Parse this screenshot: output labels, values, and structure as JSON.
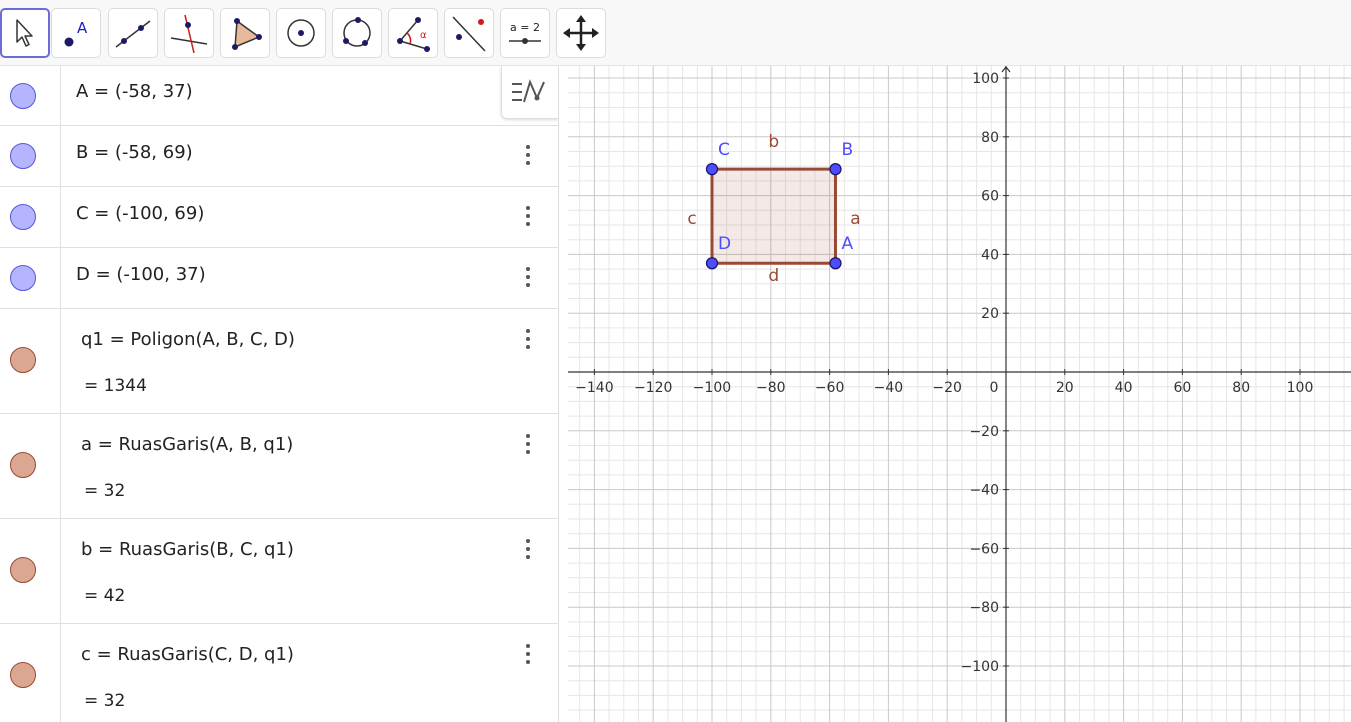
{
  "toolbar": {
    "tools": [
      {
        "name": "move",
        "label": "",
        "icon": "arrow-cursor-icon",
        "active": true
      },
      {
        "name": "point",
        "label": "A",
        "icon": "point-icon",
        "active": false
      },
      {
        "name": "line",
        "label": "",
        "icon": "line-icon",
        "active": false
      },
      {
        "name": "perpendicular",
        "label": "",
        "icon": "perpendicular-line-icon",
        "active": false
      },
      {
        "name": "polygon",
        "label": "",
        "icon": "polygon-icon",
        "active": false
      },
      {
        "name": "circle-center",
        "label": "",
        "icon": "circle-center-icon",
        "active": false
      },
      {
        "name": "circle-3-points",
        "label": "",
        "icon": "circle-three-points-icon",
        "active": false
      },
      {
        "name": "angle",
        "label": "α",
        "icon": "angle-icon",
        "active": false
      },
      {
        "name": "reflect",
        "label": "",
        "icon": "reflect-icon",
        "active": false
      },
      {
        "name": "slider",
        "label": "a = 2",
        "icon": "slider-icon",
        "active": false
      },
      {
        "name": "move-graphics",
        "label": "",
        "icon": "move-arrows-icon",
        "active": false
      }
    ]
  },
  "algebra": {
    "rows": [
      {
        "def": "A = (-58, 37)",
        "value": "",
        "type": "point"
      },
      {
        "def": "B = (-58, 69)",
        "value": "",
        "type": "point"
      },
      {
        "def": "C = (-100, 69)",
        "value": "",
        "type": "point"
      },
      {
        "def": "D = (-100, 37)",
        "value": "",
        "type": "point"
      },
      {
        "def": "q1  =  Poligon(A, B, C, D)",
        "value": "=  1344",
        "type": "shape"
      },
      {
        "def": "a  =  RuasGaris(A, B, q1)",
        "value": "=  32",
        "type": "shape"
      },
      {
        "def": "b  =  RuasGaris(B, C, q1)",
        "value": "=  42",
        "type": "shape"
      },
      {
        "def": "c  =  RuasGaris(C, D, q1)",
        "value": "=  32",
        "type": "shape"
      }
    ]
  },
  "graphics": {
    "x_ticks": [
      "−140",
      "−120",
      "−100",
      "−80",
      "−60",
      "−40",
      "−20",
      "0",
      "20",
      "40",
      "60",
      "80",
      "100"
    ],
    "y_ticks": [
      "100",
      "80",
      "60",
      "40",
      "20",
      "−20",
      "−40",
      "−60",
      "−80",
      "−100"
    ],
    "points": [
      {
        "name": "A",
        "x": -58,
        "y": 37
      },
      {
        "name": "B",
        "x": -58,
        "y": 69
      },
      {
        "name": "C",
        "x": -100,
        "y": 69
      },
      {
        "name": "D",
        "x": -100,
        "y": 37
      }
    ],
    "segments": [
      {
        "name": "a",
        "from": "A",
        "to": "B"
      },
      {
        "name": "b",
        "from": "B",
        "to": "C"
      },
      {
        "name": "c",
        "from": "C",
        "to": "D"
      },
      {
        "name": "d",
        "from": "D",
        "to": "A"
      }
    ],
    "polygon": {
      "name": "q1",
      "vertices": [
        "A",
        "B",
        "C",
        "D"
      ]
    },
    "colors": {
      "point_fill": "#4d4dff",
      "point_stroke": "#1a1a66",
      "point_label": "#4d4dff",
      "segment": "#994a33",
      "segment_label": "#994a33",
      "polygon_fill": "#994a33",
      "axis": "#333333",
      "grid_major": "#c8c8c8",
      "grid_minor": "#e6e6e6"
    }
  }
}
